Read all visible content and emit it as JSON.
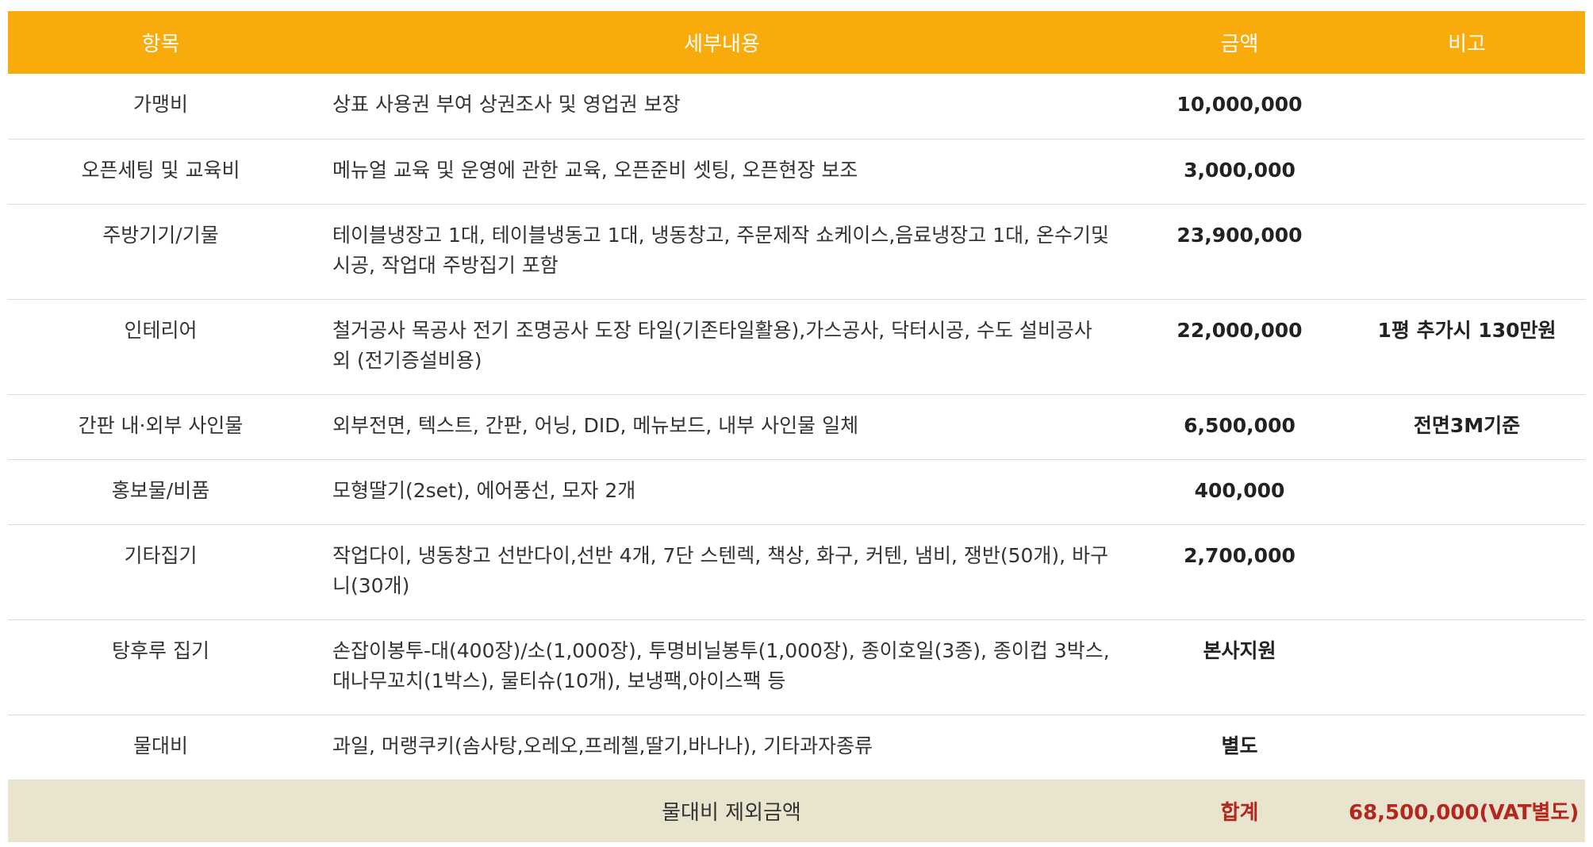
{
  "header": {
    "col_item": "항목",
    "col_detail": "세부내용",
    "col_amount": "금액",
    "col_note": "비고"
  },
  "rows": [
    {
      "item": "가맹비",
      "detail": "상표 사용권 부여 상권조사 및 영업권 보장",
      "amount": "10,000,000",
      "note": ""
    },
    {
      "item": "오픈세팅 및 교육비",
      "detail": "메뉴얼 교육 및 운영에 관한 교육, 오픈준비 셋팅, 오픈현장 보조",
      "amount": "3,000,000",
      "note": ""
    },
    {
      "item": "주방기기/기물",
      "detail": "테이블냉장고 1대, 테이블냉동고 1대, 냉동창고, 주문제작 쇼케이스,음료냉장고 1대, 온수기및 시공, 작업대 주방집기 포함",
      "amount": "23,900,000",
      "note": ""
    },
    {
      "item": "인테리어",
      "detail": "철거공사 목공사 전기 조명공사 도장 타일(기존타일활용),가스공사, 닥터시공, 수도 설비공사 외 (전기증설비용)",
      "amount": "22,000,000",
      "note": "1평 추가시 130만원"
    },
    {
      "item": "간판 내·외부 사인물",
      "detail": "외부전면, 텍스트, 간판, 어닝, DID, 메뉴보드, 내부 사인물 일체",
      "amount": "6,500,000",
      "note": "전면3M기준"
    },
    {
      "item": "홍보물/비품",
      "detail": "모형딸기(2set), 에어풍선, 모자 2개",
      "amount": "400,000",
      "note": ""
    },
    {
      "item": "기타집기",
      "detail": "작업다이, 냉동창고 선반다이,선반 4개, 7단 스텐렉, 책상, 화구, 커텐, 냄비, 쟁반(50개), 바구니(30개)",
      "amount": "2,700,000",
      "note": ""
    },
    {
      "item": "탕후루 집기",
      "detail": "손잡이봉투-대(400장)/소(1,000장), 투명비닐봉투(1,000장), 종이호일(3종), 종이컵 3박스, 대나무꼬치(1박스), 물티슈(10개), 보냉팩,아이스팩 등",
      "amount": "본사지원",
      "note": ""
    },
    {
      "item": "물대비",
      "detail": "과일, 머랭쿠키(솜사탕,오레오,프레첼,딸기,바나나), 기타과자종류",
      "amount": "별도",
      "note": ""
    }
  ],
  "footer": {
    "desc": "물대비 제외금액",
    "label": "합계",
    "value": "68,500,000(VAT별도)"
  },
  "colors": {
    "header_bg": "#f9ab0c",
    "footer_bg": "#e8e4ce",
    "total_text": "#b5261e"
  }
}
